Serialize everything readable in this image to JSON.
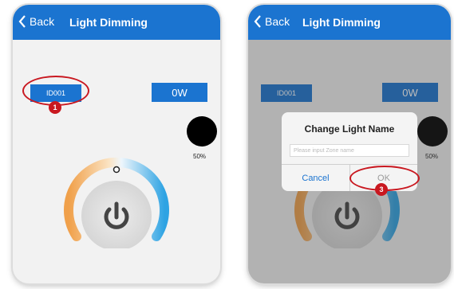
{
  "colors": {
    "accent": "#1b74d0",
    "annotation": "#c91820",
    "dial_warm": "#f0a04a",
    "dial_cool": "#2ea3e3"
  },
  "screen1": {
    "back_label": "Back",
    "title": "Light Dimming",
    "id_label": "ID001",
    "power_label": "0W",
    "brightness": "50%",
    "annotation": "1"
  },
  "screen2": {
    "back_label": "Back",
    "title": "Light Dimming",
    "id_label": "ID001",
    "power_label": "0W",
    "brightness": "50%",
    "dialog": {
      "title": "Change Light Name",
      "placeholder": "Please input Zone name",
      "cancel_label": "Cancel",
      "ok_label": "OK"
    },
    "annotation": "3"
  },
  "icons": {
    "back": "chevron-left-icon",
    "power": "power-icon"
  }
}
